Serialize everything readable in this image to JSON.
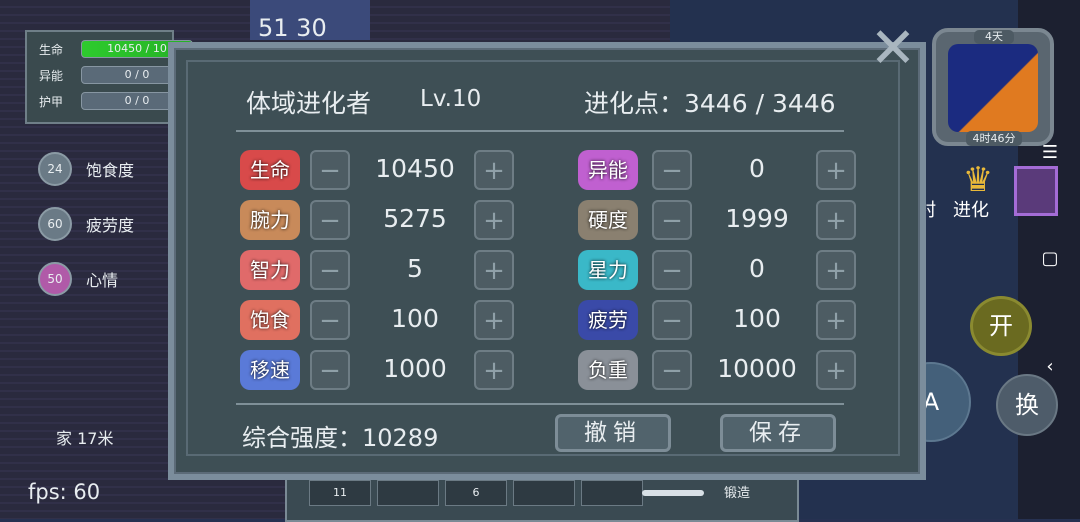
{
  "hud": {
    "stats": [
      {
        "label": "生命",
        "value": "10450 / 10"
      },
      {
        "label": "异能",
        "value": "0 / 0"
      },
      {
        "label": "护甲",
        "value": "0 / 0"
      }
    ],
    "top_numbers": "51  30",
    "status": [
      {
        "icon": "food-icon",
        "value": "24",
        "label": "饱食度"
      },
      {
        "icon": "fatigue-icon",
        "value": "60",
        "label": "疲劳度"
      },
      {
        "icon": "mood-icon",
        "value": "50",
        "label": "心情"
      }
    ],
    "home_distance": "家 17米",
    "fps": "fps: 60",
    "bottom_slots": [
      "11",
      "",
      "6",
      "",
      ""
    ],
    "bottom_label": "锻造"
  },
  "panel": {
    "title_name": "体域进化者",
    "title_level": "Lv.10",
    "title_points": "进化点：3446 / 3446",
    "minus": "−",
    "plus": "+",
    "left_attrs": [
      {
        "label": "生命",
        "value": "10450",
        "icon": "heart-icon",
        "color": "#d84a4a"
      },
      {
        "label": "腕力",
        "value": "5275",
        "icon": "arm-icon",
        "color": "#c88a5a"
      },
      {
        "label": "智力",
        "value": "5",
        "icon": "brain-icon",
        "color": "#e06a6a"
      },
      {
        "label": "饱食",
        "value": "100",
        "icon": "food-icon",
        "color": "#e07060"
      },
      {
        "label": "移速",
        "value": "1000",
        "icon": "shoe-icon",
        "color": "#5a7ad8"
      }
    ],
    "right_attrs": [
      {
        "label": "异能",
        "value": "0",
        "icon": "star-icon",
        "color": "#c060d0"
      },
      {
        "label": "硬度",
        "value": "1999",
        "icon": "shield-icon",
        "color": "#8a8070"
      },
      {
        "label": "星力",
        "value": "0",
        "icon": "crystal-icon",
        "color": "#3ab8c8"
      },
      {
        "label": "疲劳",
        "value": "100",
        "icon": "fatigue-icon",
        "color": "#3a4aa8"
      },
      {
        "label": "负重",
        "value": "10000",
        "icon": "weight-icon",
        "color": "#8a9098"
      }
    ],
    "total": "综合强度：10289",
    "undo": "撤销",
    "save": "保存"
  },
  "right_ui": {
    "clock_day": "4天",
    "clock_time": "4时46分",
    "village": "村",
    "evolve": "进化",
    "open_btn": "开",
    "a_btn": "A",
    "swap_btn": "换"
  }
}
